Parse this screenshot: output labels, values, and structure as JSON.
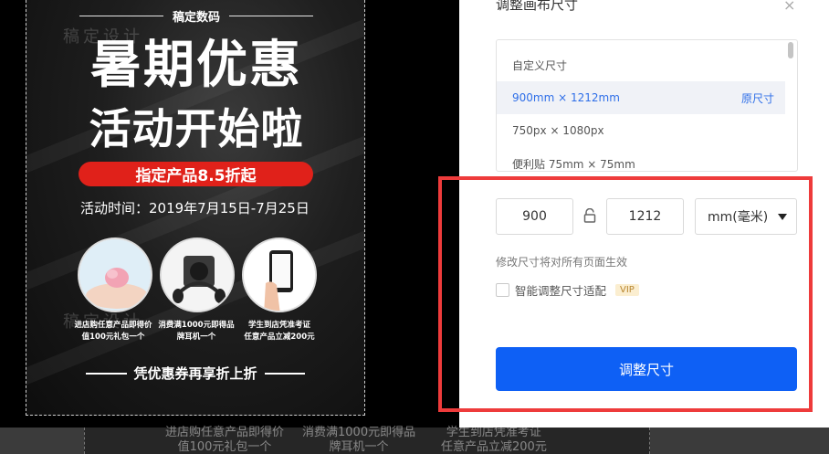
{
  "poster": {
    "brand": "稿定数码",
    "watermark": "稿定设计",
    "title_line1": "暑期优惠",
    "title_line2": "活动开始啦",
    "badge": "指定产品8.5折起",
    "date": "活动时间：2019年7月15日-7月25日",
    "captions": [
      {
        "line1": "进店购任意产品即得价",
        "line2": "值100元礼包一个"
      },
      {
        "line1": "消费满1000元即得品",
        "line2": "牌耳机一个"
      },
      {
        "line1": "学生到店凭准考证",
        "line2": "任意产品立减200元"
      }
    ],
    "footer": "凭优惠券再享折上折"
  },
  "dialog": {
    "title": "调整画布尺寸",
    "close_glyph": "×",
    "presets": [
      {
        "label": "自定义尺寸",
        "tag": ""
      },
      {
        "label": "900mm × 1212mm",
        "tag": "原尺寸"
      },
      {
        "label": "750px × 1080px",
        "tag": ""
      },
      {
        "label": "便利贴 75mm × 75mm",
        "tag": ""
      }
    ],
    "width_value": "900",
    "height_value": "1212",
    "unit": "mm(毫米)",
    "hint": "修改尺寸将对所有页面生效",
    "smart_fit_label": "智能调整尺寸适配",
    "vip_badge": "VIP",
    "submit_label": "调整尺寸"
  },
  "bottom_ghost": {
    "col1_line1": "进店购任意产品即得价",
    "col1_line2": "值100元礼包一个",
    "col2_line1": "消费满1000元即得品",
    "col2_line2": "牌耳机一个",
    "col3_line1": "学生到店凭准考证",
    "col3_line2": "任意产品立减200元"
  },
  "colors": {
    "primary": "#0e60f5",
    "badge_red": "#e0211a",
    "highlight_red": "#ee3b3b",
    "selected_text": "#2f6fe8"
  }
}
